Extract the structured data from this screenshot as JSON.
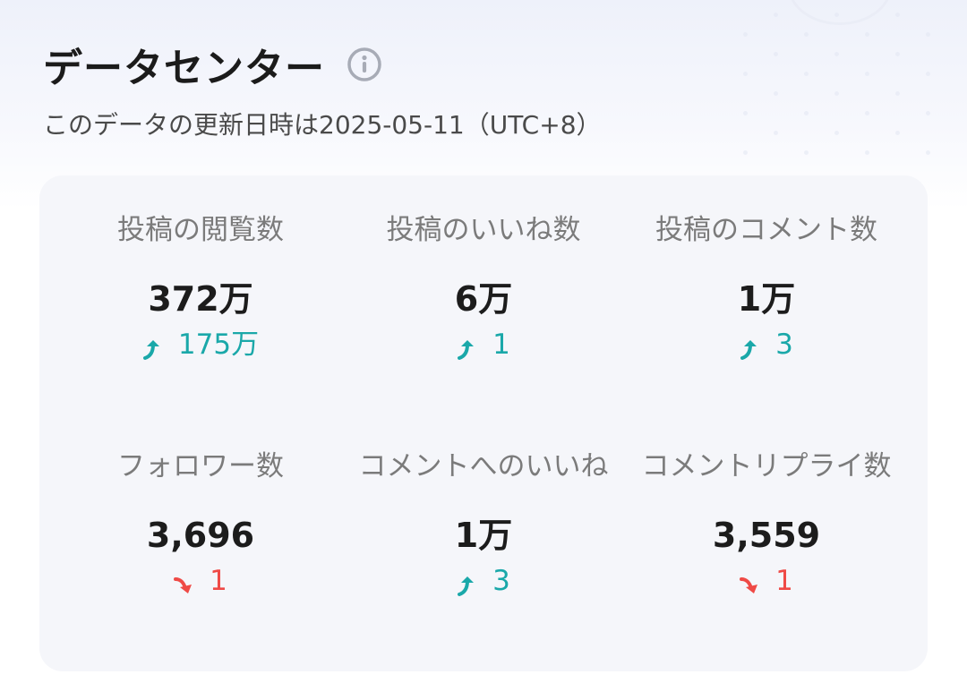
{
  "header": {
    "title": "データセンター",
    "subtitle": "このデータの更新日時は2025-05-11（UTC+8）"
  },
  "stats": [
    {
      "label": "投稿の閲覧数",
      "value": "372万",
      "delta": "175万",
      "trend": "up"
    },
    {
      "label": "投稿のいいね数",
      "value": "6万",
      "delta": "1",
      "trend": "up"
    },
    {
      "label": "投稿のコメント数",
      "value": "1万",
      "delta": "3",
      "trend": "up"
    },
    {
      "label": "フォロワー数",
      "value": "3,696",
      "delta": "1",
      "trend": "down"
    },
    {
      "label": "コメントへのいいね",
      "value": "1万",
      "delta": "3",
      "trend": "up"
    },
    {
      "label": "コメントリプライ数",
      "value": "3,559",
      "delta": "1",
      "trend": "down"
    }
  ],
  "colors": {
    "up": "#1aa8a9",
    "down": "#ef4a46",
    "card_bg": "#f5f6fa"
  },
  "icons": {
    "info": "info-icon",
    "up": "trend-up-arrow-icon",
    "down": "trend-down-arrow-icon"
  }
}
